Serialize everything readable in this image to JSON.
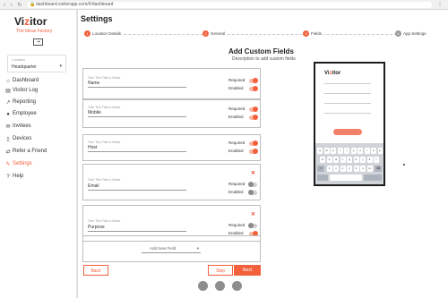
{
  "browser": {
    "url": "dashboard.vizitorapp.com/#/dashboard"
  },
  "sidebar": {
    "logo_main": "Vi",
    "logo_accent": "z",
    "logo_rest": "itor",
    "tagline": "The Ideas Factory",
    "login_icon": "login-icon",
    "location_label": "Location",
    "location_value": "Headquarter",
    "items": [
      {
        "label": "Dashboard",
        "icon": "home-icon",
        "active": false
      },
      {
        "label": "Visitor Log",
        "icon": "book-icon",
        "active": false
      },
      {
        "label": "Reporting",
        "icon": "chart-icon",
        "active": false
      },
      {
        "label": "Employee",
        "icon": "person-icon",
        "active": false
      },
      {
        "label": "Invitees",
        "icon": "mail-icon",
        "active": false
      },
      {
        "label": "Devices",
        "icon": "tablet-icon",
        "active": false
      },
      {
        "label": "Refer a Friend",
        "icon": "share-icon",
        "active": false
      },
      {
        "label": "Settings",
        "icon": "settings-icon",
        "active": true
      },
      {
        "label": "Help",
        "icon": "help-icon",
        "active": false
      }
    ]
  },
  "main": {
    "title": "Settings",
    "steps": [
      {
        "num": "1",
        "label": "Location Details"
      },
      {
        "num": "2",
        "label": "General"
      },
      {
        "num": "3",
        "label": "Fields"
      },
      {
        "num": "4",
        "label": "App Settings"
      }
    ],
    "heading": "Add Custom Fields",
    "subheading": "Description to add custom fields",
    "field_placeholder": "Give This Field a Name",
    "required_label": "Required",
    "enabled_label": "Enabled",
    "fields": [
      {
        "value": "Name"
      },
      {
        "value": "Mobile"
      },
      {
        "value": "Host"
      },
      {
        "value": "Email"
      },
      {
        "value": "Purpose"
      }
    ],
    "add_new_field": "Add New Field",
    "back": "Back",
    "skip": "Skip",
    "next": "Next"
  },
  "colors": {
    "accent": "#f2603c"
  }
}
